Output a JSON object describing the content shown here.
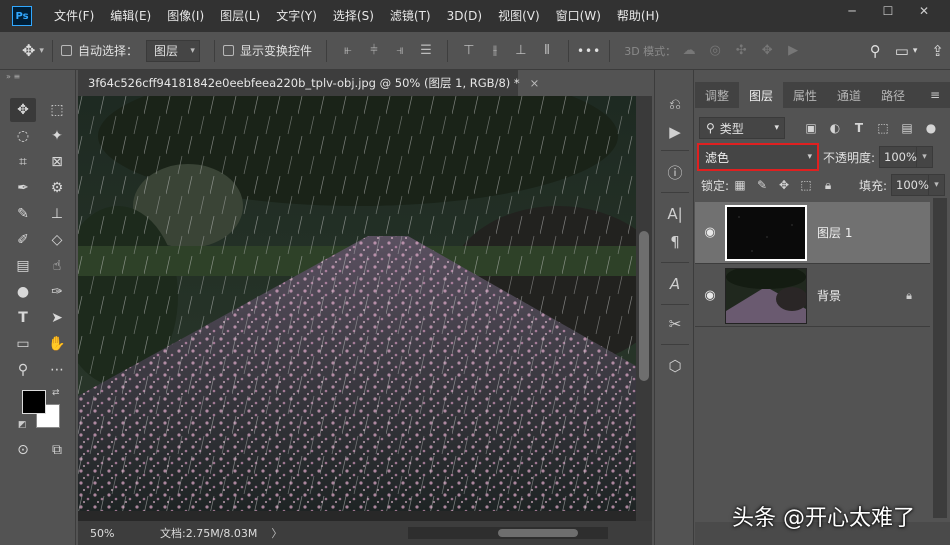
{
  "app": {
    "logo": "Ps"
  },
  "menu": [
    "文件(F)",
    "编辑(E)",
    "图像(I)",
    "图层(L)",
    "文字(Y)",
    "选择(S)",
    "滤镜(T)",
    "3D(D)",
    "视图(V)",
    "窗口(W)",
    "帮助(H)"
  ],
  "window_controls": {
    "minimize": "─",
    "restore": "☐",
    "close": "✕"
  },
  "options": {
    "auto_select_label": "自动选择：",
    "auto_select_value": "图层",
    "show_transform_label": "显示变换控件",
    "more": "•••",
    "mode3d_label": "3D 模式："
  },
  "document": {
    "tab_title": "3f64c526cff94181842e0eebfeea220b_tplv-obj.jpg @ 50% (图层 1, RGB/8) *",
    "close": "×",
    "zoom": "50%",
    "doc_size": "文档:2.75M/8.03M",
    "arrow": "〉"
  },
  "panel": {
    "tabs": [
      "调整",
      "图层",
      "属性",
      "通道",
      "路径"
    ],
    "active_tab": "图层",
    "filter_kind": "类型",
    "blend_mode": "滤色",
    "opacity_label": "不透明度:",
    "opacity_value": "100%",
    "lock_label": "锁定:",
    "fill_label": "填充:",
    "fill_value": "100%",
    "layers": [
      {
        "name": "图层 1",
        "selected": true,
        "locked": false
      },
      {
        "name": "背景",
        "selected": false,
        "locked": true
      }
    ]
  },
  "watermark": "头条 @开心太难了",
  "colors": {
    "accent_red": "#e02020",
    "foreground": "#000000",
    "background": "#ffffff"
  }
}
